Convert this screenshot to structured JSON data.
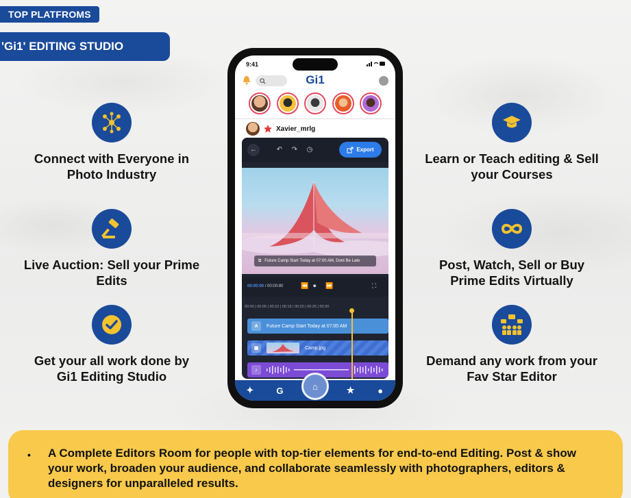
{
  "header": {
    "tag": "TOP PLATFROMS",
    "studio_title": "'Gi1' EDITING STUDIO"
  },
  "features_left": [
    {
      "icon": "network-people-icon",
      "text": "Connect with Everyone in Photo Industry"
    },
    {
      "icon": "auction-gavel-icon",
      "text": "Live Auction: Sell your Prime Edits"
    },
    {
      "icon": "check-circle-icon",
      "text": "Get your all work done by Gi1 Editing Studio"
    }
  ],
  "features_right": [
    {
      "icon": "graduation-cap-icon",
      "text": "Learn or Teach editing & Sell your Courses"
    },
    {
      "icon": "infinity-icon",
      "text": "Post, Watch, Sell or Buy Prime Edits Virtually"
    },
    {
      "icon": "team-presentation-icon",
      "text": "Demand any work from your Fav Star Editor"
    }
  ],
  "phone": {
    "status_time": "9:41",
    "app_title": "Gi1",
    "username": "Xavier_mrlg",
    "export_label": "Export",
    "caption": "Future Camp Start Today at 07:00 AM, Dont Be Late",
    "timecode_current": "00:00:00",
    "timecode_total": "/ 00:00:80",
    "ruler": "00:00  |  00:05  |  00:10  |  00:15  |  00:20  |  00:25  |  00:30",
    "track_text_label": "A",
    "track_text": "Future Camp Start Today at 07:00 AM",
    "track_image": "Camp.jpg",
    "nav": [
      "sparkle-icon",
      "g-logo-icon",
      "home-icon",
      "star-icon",
      "profile-icon"
    ]
  },
  "banner": {
    "bullet": "•",
    "text": "A Complete Editors Room for people with top-tier elements for end-to-end Editing. Post & show your work, broaden your audience, and collaborate seamlessly with photographers, editors & designers for unparalleled results."
  },
  "colors": {
    "brand_blue": "#1a4a9a",
    "accent_yellow": "#f8c94a",
    "icon_yellow": "#f2c230"
  }
}
